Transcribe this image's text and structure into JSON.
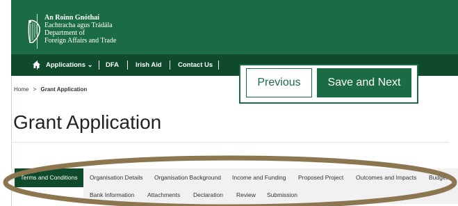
{
  "brand": {
    "line1": "An Roinn Gnóthaí",
    "line2": "Eachtracha agus Trádála",
    "line3": "Department of",
    "line4": "Foreign Affairs and Trade"
  },
  "nav": {
    "items": [
      {
        "label": "Applications ⌄"
      },
      {
        "label": "DFA"
      },
      {
        "label": "Irish Aid"
      },
      {
        "label": "Contact Us"
      }
    ]
  },
  "breadcrumb": {
    "home": "Home",
    "separator": ">",
    "current": "Grant Application"
  },
  "page_title": "Grant Application",
  "actions": {
    "previous": "Previous",
    "save_next": "Save and Next"
  },
  "tabs": {
    "row1": [
      {
        "label": "Terms and Conditions",
        "active": true
      },
      {
        "label": "Organisation Details"
      },
      {
        "label": "Organisation Background"
      },
      {
        "label": "Income and Funding"
      },
      {
        "label": "Proposed Project"
      },
      {
        "label": "Outcomes and Impacts"
      },
      {
        "label": "Budget"
      }
    ],
    "row2": [
      {
        "label": "Bank Information"
      },
      {
        "label": "Attachments"
      },
      {
        "label": "Declaration"
      },
      {
        "label": "Review"
      },
      {
        "label": "Submission"
      }
    ]
  },
  "colors": {
    "brand_green": "#1b6b44",
    "nav_green": "#0f4a2d",
    "annotation_ring": "#8b7650"
  },
  "icons": {
    "logo": "harp-icon",
    "home": "home-icon"
  }
}
